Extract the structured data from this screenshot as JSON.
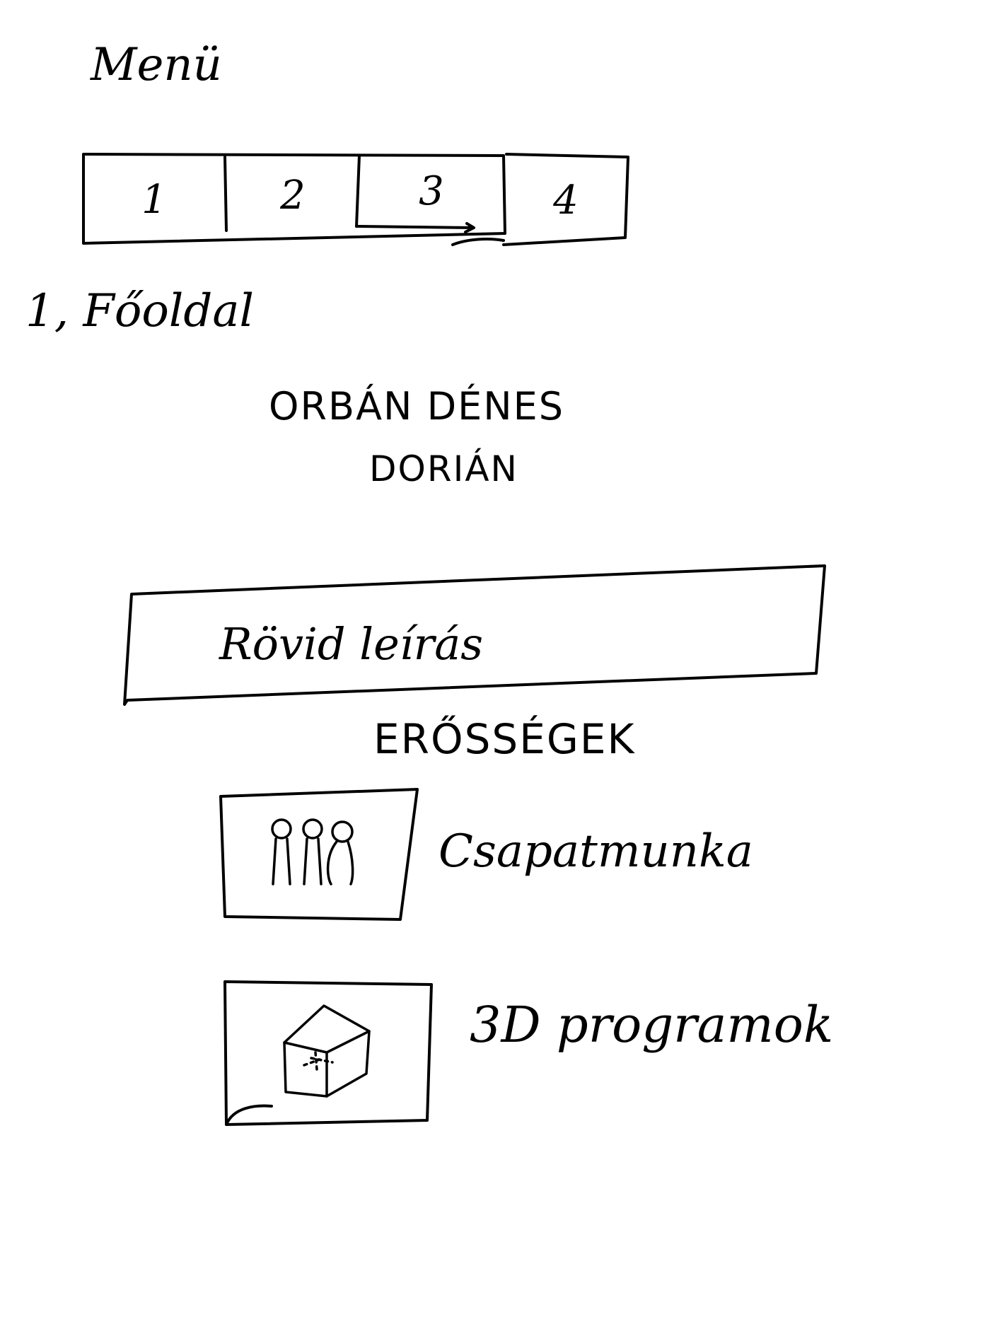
{
  "menu": {
    "title": "Menü",
    "tabs": [
      "1",
      "2",
      "3",
      "4"
    ]
  },
  "page": {
    "heading": "1, Főoldal",
    "name_line1": "ORBÁN DÉNES",
    "name_line2": "DORIÁN",
    "intro_box": "Rövid leírás",
    "strengths_title": "ERŐSSÉGEK",
    "strengths": [
      {
        "label": "Csapatmunka",
        "icon": "people-icon"
      },
      {
        "label": "3D programok",
        "icon": "cube-icon"
      }
    ]
  }
}
